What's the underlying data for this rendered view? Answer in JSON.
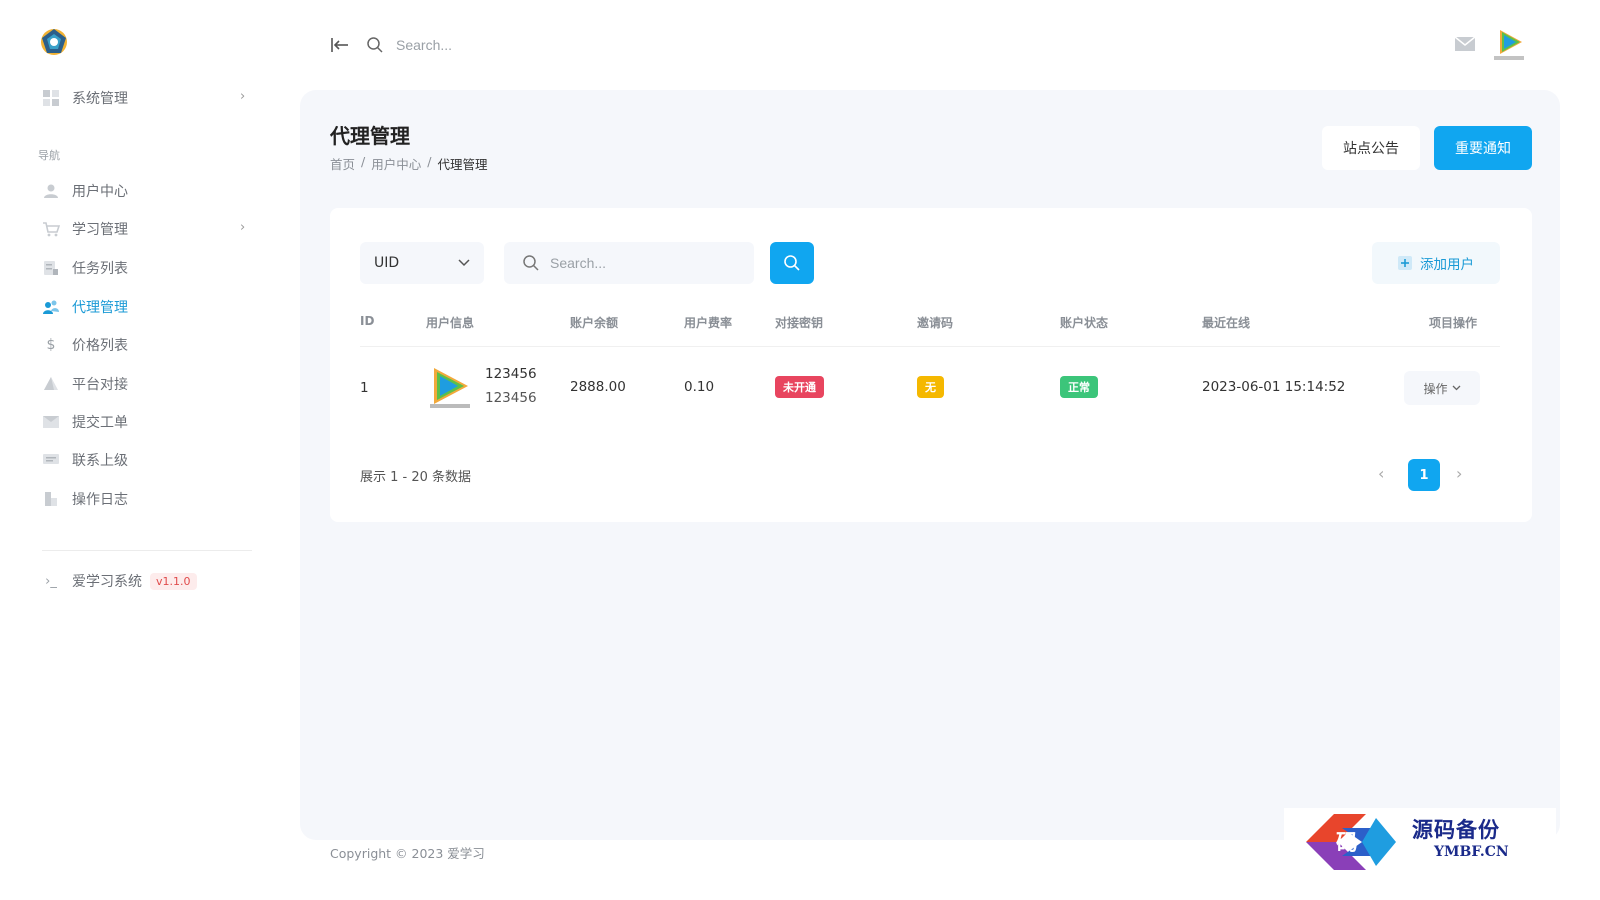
{
  "sidebar": {
    "system_label": "系统管理",
    "nav_heading": "导航",
    "items": [
      {
        "label": "用户中心",
        "icon": "user-icon"
      },
      {
        "label": "学习管理",
        "icon": "cart-icon"
      },
      {
        "label": "任务列表",
        "icon": "task-icon"
      },
      {
        "label": "代理管理",
        "icon": "agents-icon"
      },
      {
        "label": "价格列表",
        "icon": "dollar-icon"
      },
      {
        "label": "平台对接",
        "icon": "platform-icon"
      },
      {
        "label": "提交工单",
        "icon": "mail-icon"
      },
      {
        "label": "联系上级",
        "icon": "chat-icon"
      },
      {
        "label": "操作日志",
        "icon": "log-icon"
      }
    ],
    "app_name": "爱学习系统",
    "version": "v1.1.0",
    "accent": "#1a9ad6"
  },
  "topbar": {
    "search_placeholder": "Search..."
  },
  "page": {
    "title": "代理管理",
    "breadcrumb": [
      "首页",
      "/",
      "用户中心",
      "/",
      "代理管理"
    ],
    "btn_notice": "站点公告",
    "btn_important": "重要通知"
  },
  "filter": {
    "select_value": "UID",
    "search_placeholder": "Search...",
    "add_user": "添加用户"
  },
  "table": {
    "headers": [
      "ID",
      "用户信息",
      "账户余额",
      "用户费率",
      "对接密钥",
      "邀请码",
      "账户状态",
      "最近在线",
      "项目操作"
    ],
    "rows": [
      {
        "id": "1",
        "user_name": "123456",
        "user_account": "123456",
        "balance": "2888.00",
        "rate": "0.10",
        "key_status": "未开通",
        "invite_code": "无",
        "account_status": "正常",
        "last_online": "2023-06-01 15:14:52",
        "action": "操作"
      }
    ]
  },
  "pagination": {
    "summary": "展示 1 - 20 条数据",
    "current": "1"
  },
  "footer": {
    "copyright": "Copyright © 2023 爱学习"
  },
  "watermark": {
    "cn": "源码备份",
    "en": "YMBF.CN",
    "logo_char": "码"
  },
  "colors": {
    "primary": "#10a6f0",
    "badge_red": "#e8455f",
    "badge_yellow": "#f5b800",
    "badge_green": "#3cc57a"
  }
}
